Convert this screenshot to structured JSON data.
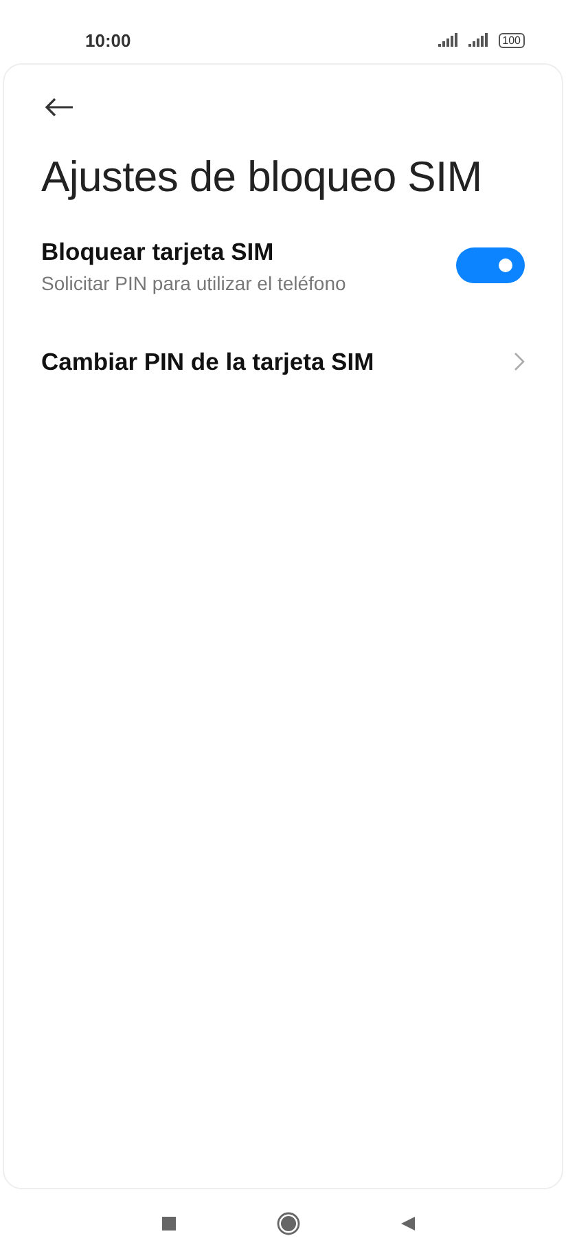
{
  "status_bar": {
    "time": "10:00",
    "battery": "100"
  },
  "title": "Ajustes de bloqueo SIM",
  "settings": [
    {
      "kind": "toggle",
      "label": "Bloquear tarjeta SIM",
      "summary": "Solicitar PIN para utilizar el teléfono",
      "on": true
    },
    {
      "kind": "link",
      "label": "Cambiar PIN de la tarjeta SIM"
    }
  ]
}
